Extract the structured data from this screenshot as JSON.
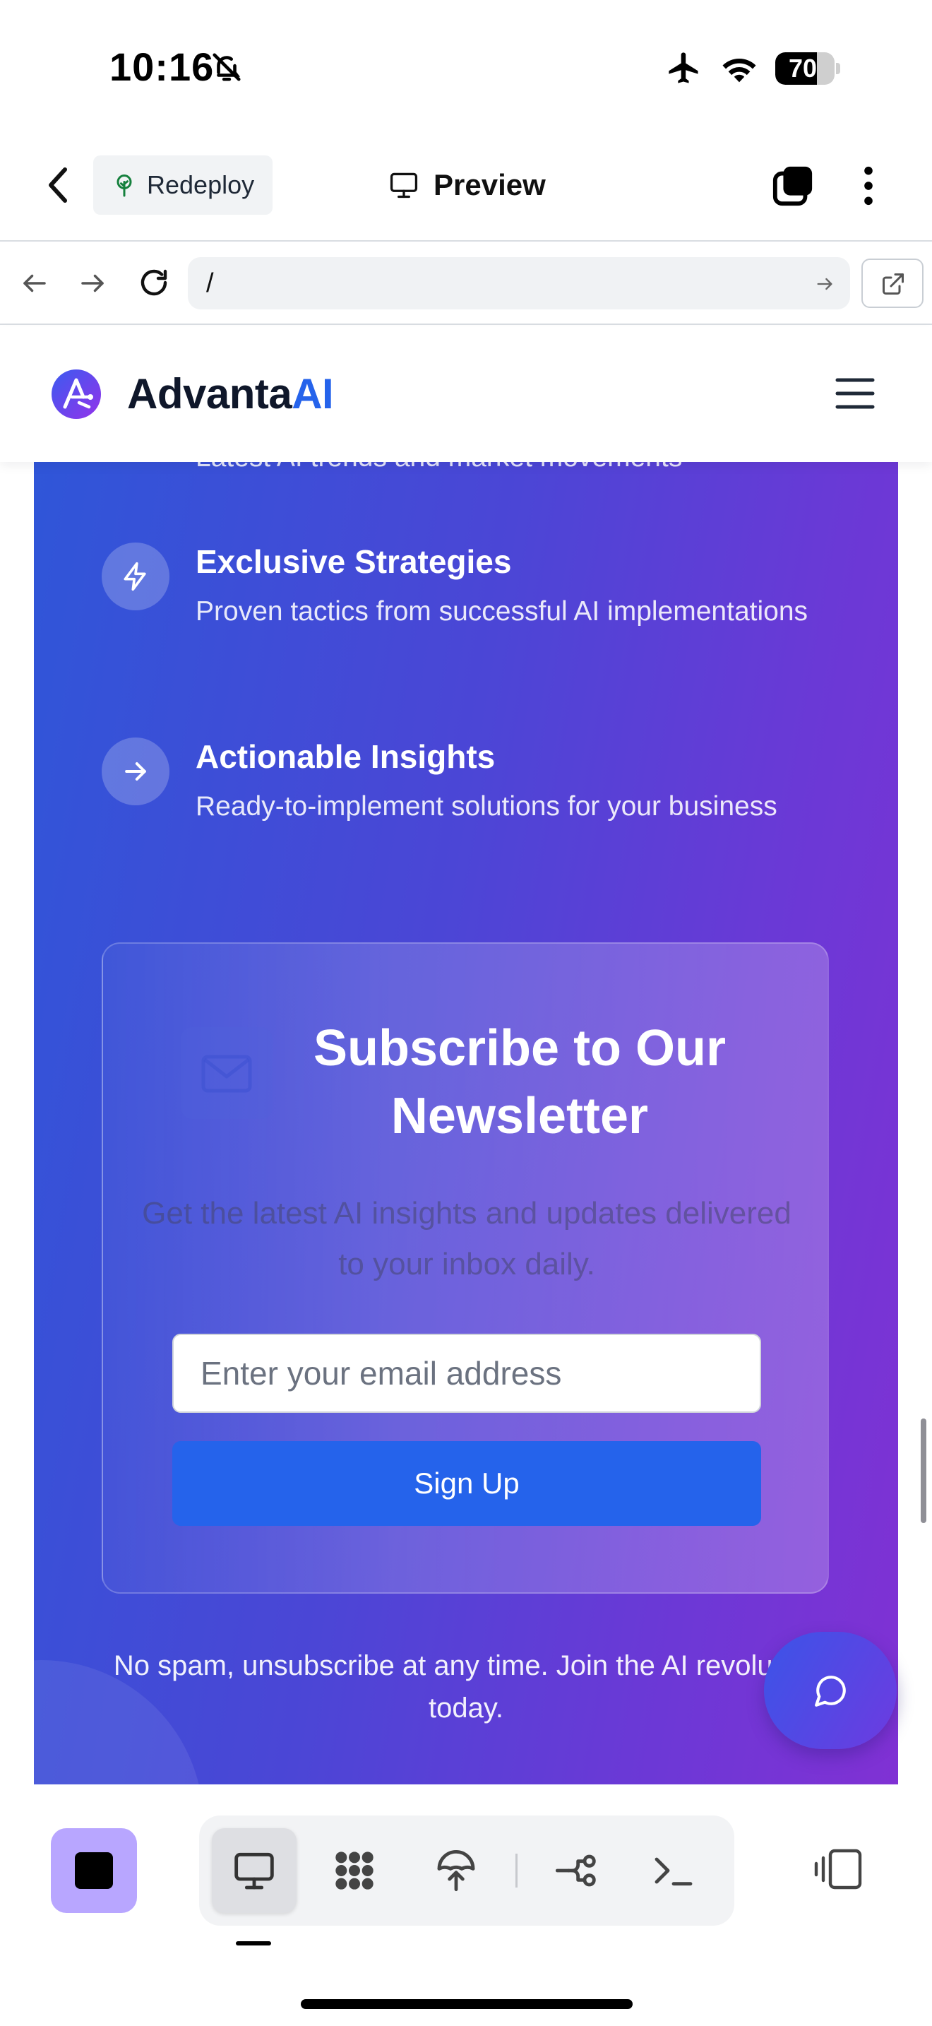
{
  "status_bar": {
    "time": "10:16",
    "battery_level": "70",
    "battery_fraction": 0.7
  },
  "toolbar": {
    "redeploy_label": "Redeploy",
    "preview_label": "Preview"
  },
  "browser": {
    "url": "/"
  },
  "site_header": {
    "brand_main": "Advanta",
    "brand_accent": "AI"
  },
  "hero": {
    "clipped_text": "Latest AI trends and market movements",
    "features": [
      {
        "title": "Exclusive Strategies",
        "description": "Proven tactics from successful AI implementations",
        "icon": "lightning-icon"
      },
      {
        "title": "Actionable Insights",
        "description": "Ready-to-implement solutions for your business",
        "icon": "arrow-right-icon"
      }
    ]
  },
  "newsletter": {
    "title": "Subscribe to Our Newsletter",
    "subtitle": "Get the latest AI insights and updates delivered to your inbox daily.",
    "email_placeholder": "Enter your email address",
    "signup_label": "Sign Up",
    "footnote": "No spam, unsubscribe at any time. Join the AI revolution today."
  },
  "colors": {
    "accent": "#2563eb",
    "gradient_start": "#2f56d8",
    "gradient_end": "#8031d4",
    "stop_button": "#b8a6ff"
  },
  "dock": {
    "items": [
      "monitor-icon",
      "apps-grid-icon",
      "deploy-icon",
      "workflow-icon",
      "terminal-icon"
    ],
    "active": "monitor-icon"
  }
}
